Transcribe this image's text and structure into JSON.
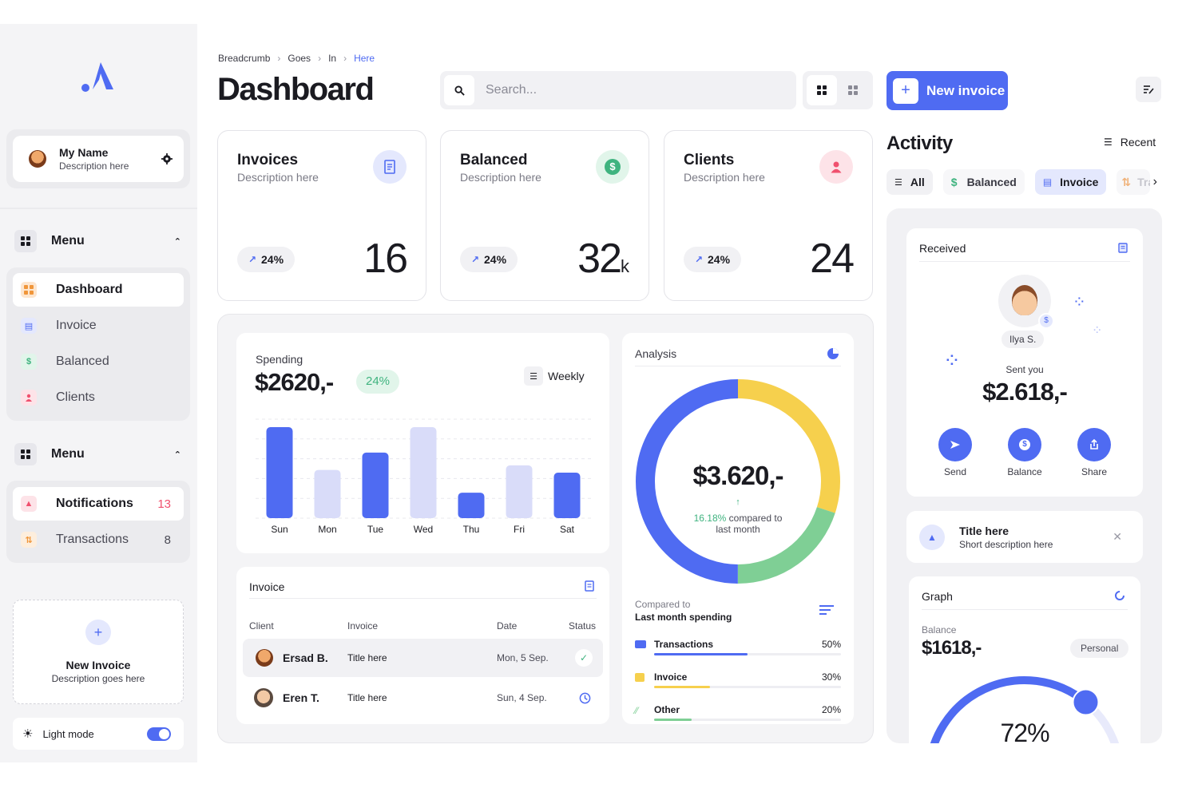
{
  "sidebar": {
    "profile": {
      "name": "My Name",
      "description": "Description here"
    },
    "menu1": {
      "title": "Menu",
      "items": [
        {
          "label": "Dashboard",
          "icon": "dashboard-icon"
        },
        {
          "label": "Invoice",
          "icon": "invoice-icon"
        },
        {
          "label": "Balanced",
          "icon": "dollar-icon"
        },
        {
          "label": "Clients",
          "icon": "user-icon"
        }
      ]
    },
    "menu2": {
      "title": "Menu",
      "items": [
        {
          "label": "Notifications",
          "count": "13",
          "icon": "bell-icon"
        },
        {
          "label": "Transactions",
          "count": "8",
          "icon": "transfer-icon"
        }
      ]
    },
    "new_invoice": {
      "title": "New Invoice",
      "description": "Description goes here"
    },
    "light_mode": {
      "label": "Light mode",
      "enabled": true
    }
  },
  "header": {
    "breadcrumb": [
      "Breadcrumb",
      "Goes",
      "In",
      "Here"
    ],
    "title": "Dashboard",
    "search_placeholder": "Search...",
    "new_invoice_label": "New invoice"
  },
  "stats": [
    {
      "title": "Invoices",
      "description": "Description here",
      "change": "24%",
      "value": "16",
      "suffix": "",
      "icon": "invoice-icon",
      "color": "#4f6bf2"
    },
    {
      "title": "Balanced",
      "description": "Description here",
      "change": "24%",
      "value": "32",
      "suffix": "k",
      "icon": "dollar-icon",
      "color": "#3fb37f"
    },
    {
      "title": "Clients",
      "description": "Description here",
      "change": "24%",
      "value": "24",
      "suffix": "",
      "icon": "user-icon",
      "color": "#f0506e"
    }
  ],
  "spending": {
    "label": "Spending",
    "amount": "$2620,-",
    "change": "24%",
    "period": "Weekly"
  },
  "chart_data": {
    "type": "bar",
    "categories": [
      "Sun",
      "Mon",
      "Tue",
      "Wed",
      "Thu",
      "Fri",
      "Sat"
    ],
    "values": [
      100,
      53,
      72,
      100,
      28,
      58,
      50
    ],
    "highlighted": [
      true,
      false,
      true,
      false,
      true,
      false,
      true
    ],
    "ylim": [
      0,
      100
    ],
    "grid": true,
    "colors": {
      "primary": "#4f6bf2",
      "light": "#d9dcf9"
    }
  },
  "analysis": {
    "title": "Analysis",
    "amount": "$3.620,-",
    "change_pct": "16.18%",
    "change_text": "compared to",
    "change_text2": "last month",
    "compared_label": "Compared to",
    "compared_sub": "Last month spending",
    "donut": [
      {
        "name": "Transactions",
        "value": 50,
        "color": "#4f6bf2"
      },
      {
        "name": "Invoice",
        "value": 30,
        "color": "#f6d04d"
      },
      {
        "name": "Other",
        "value": 20,
        "color": "#7fcf95"
      }
    ],
    "rows": [
      {
        "label": "Transactions",
        "pct": "50%",
        "value": 50,
        "color": "#4f6bf2"
      },
      {
        "label": "Invoice",
        "pct": "30%",
        "value": 30,
        "color": "#f6d04d"
      },
      {
        "label": "Other",
        "pct": "20%",
        "value": 20,
        "color": "#7fcf95"
      }
    ]
  },
  "invoice_table": {
    "title": "Invoice",
    "columns": [
      "Client",
      "Invoice",
      "Date",
      "Status"
    ],
    "rows": [
      {
        "client": "Ersad B.",
        "invoice": "Title here",
        "date": "Mon, 5 Sep.",
        "status": "check-icon"
      },
      {
        "client": "Eren T.",
        "invoice": "Title here",
        "date": "Sun, 4 Sep.",
        "status": "clock-icon"
      }
    ]
  },
  "activity": {
    "title": "Activity",
    "sort_label": "Recent",
    "filters": [
      "All",
      "Balanced",
      "Invoice",
      "Tra"
    ],
    "received": {
      "title": "Received",
      "person": "Ilya S.",
      "sent_label": "Sent you",
      "amount": "$2.618,-",
      "actions": [
        "Send",
        "Balance",
        "Share"
      ]
    },
    "notification": {
      "title": "Title here",
      "description": "Short description here"
    },
    "graph": {
      "title": "Graph",
      "balance_label": "Balance",
      "amount": "$1618,-",
      "tag": "Personal",
      "percent": "72%",
      "value": 72
    }
  }
}
